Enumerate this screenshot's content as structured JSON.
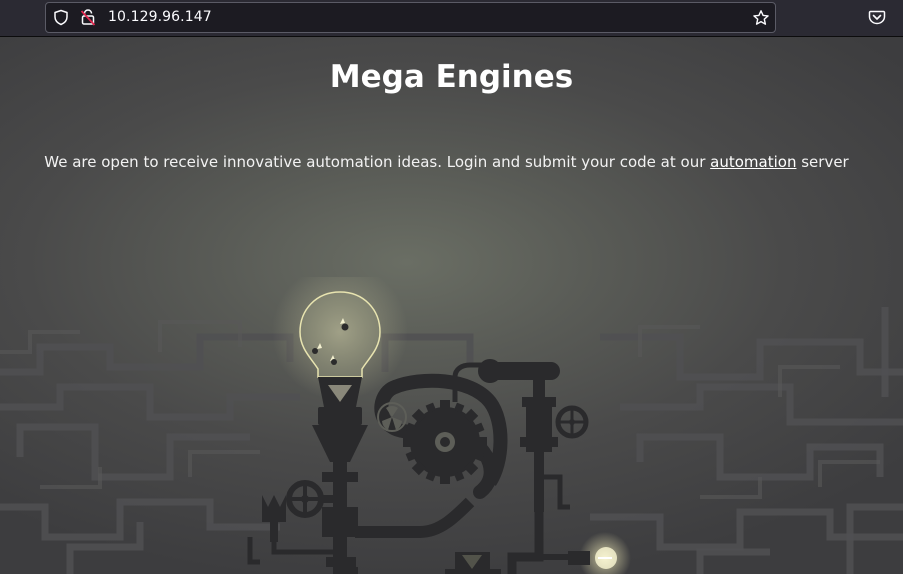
{
  "browser": {
    "url": "10.129.96.147",
    "icons": {
      "shield": "shield-icon",
      "lock": "insecure-lock-icon",
      "bookmark": "star-icon",
      "pocket": "pocket-icon"
    }
  },
  "page": {
    "title": "Mega Engines",
    "intro_text": "We are open to receive innovative automation ideas. Login and submit your code at our",
    "link_text": "automation",
    "after_link_text": "server"
  },
  "colors": {
    "toolbar_bg": "#2b2a33",
    "urlbar_bg": "#1c1b22",
    "lock_warning": "#e22850",
    "page_bg_center": "#6a6e64",
    "page_bg_edge": "#3d3d3f",
    "machine": "#2a2a2c",
    "bulb_glow": "#f3eec0"
  }
}
